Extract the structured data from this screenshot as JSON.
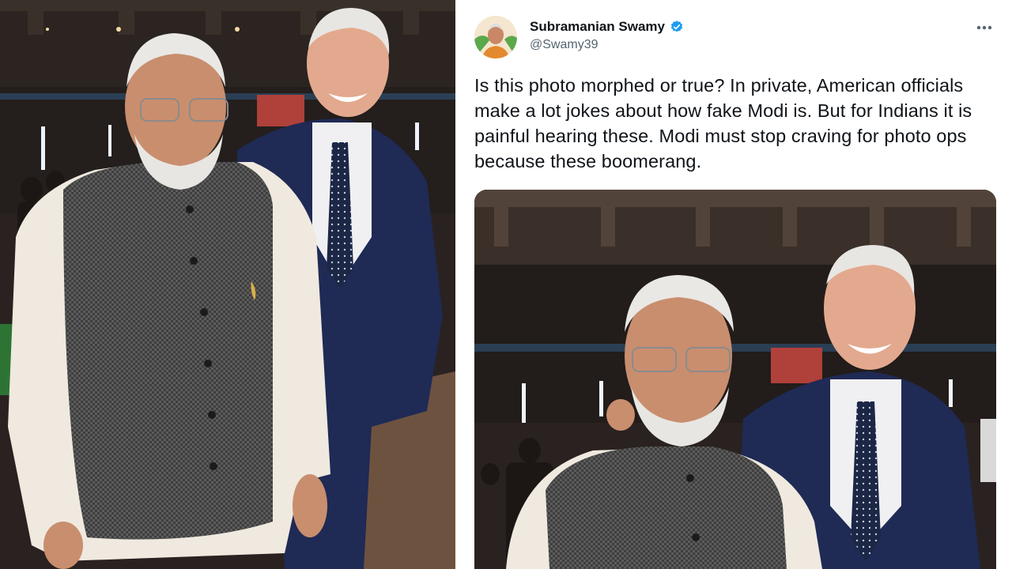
{
  "tweet": {
    "author_name": "Subramanian Swamy",
    "author_handle": "@Swamy39",
    "verified": true,
    "text": "Is this photo morphed or true? In private, American officials make a lot jokes about how fake Modi is. But for Indians it is painful hearing these. Modi must stop craving for photo ops because these boomerang.",
    "icons": {
      "verified": "verified-badge-icon",
      "more": "more-options-icon"
    }
  },
  "colors": {
    "verified_blue": "#1d9bf0",
    "text_primary": "#0f1419",
    "text_secondary": "#536471"
  }
}
